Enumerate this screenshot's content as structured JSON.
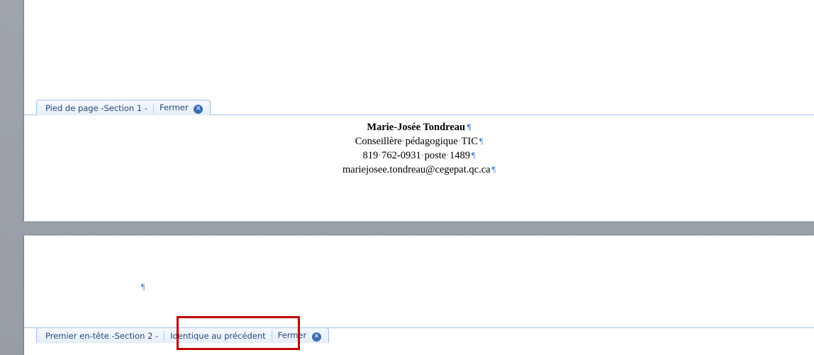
{
  "footer_section1": {
    "tab_label": "Pied de page -Section 1 -",
    "close_label": "Fermer",
    "lines": {
      "name": "Marie-Josée Tondreau",
      "title_pre": "Conseillère",
      "title_mid": "pédagogique",
      "title_post": "TIC",
      "phone_a": "819",
      "phone_b": "762-0931",
      "phone_c": "poste",
      "phone_d": "1489",
      "email": "mariejosee.tondreau@cegepat.qc.ca"
    },
    "pilcrow": "¶",
    "space_mark": "·"
  },
  "header_section2": {
    "tab_label": "Premier en-tête -Section 2 -",
    "link_label": "Identique au précédent",
    "close_label": "Fermer",
    "pilcrow": "¶"
  },
  "colors": {
    "accent": "#2a4a78",
    "rule": "#9fc1e6",
    "highlight": "#c00000",
    "background": "#9ea3ab"
  }
}
